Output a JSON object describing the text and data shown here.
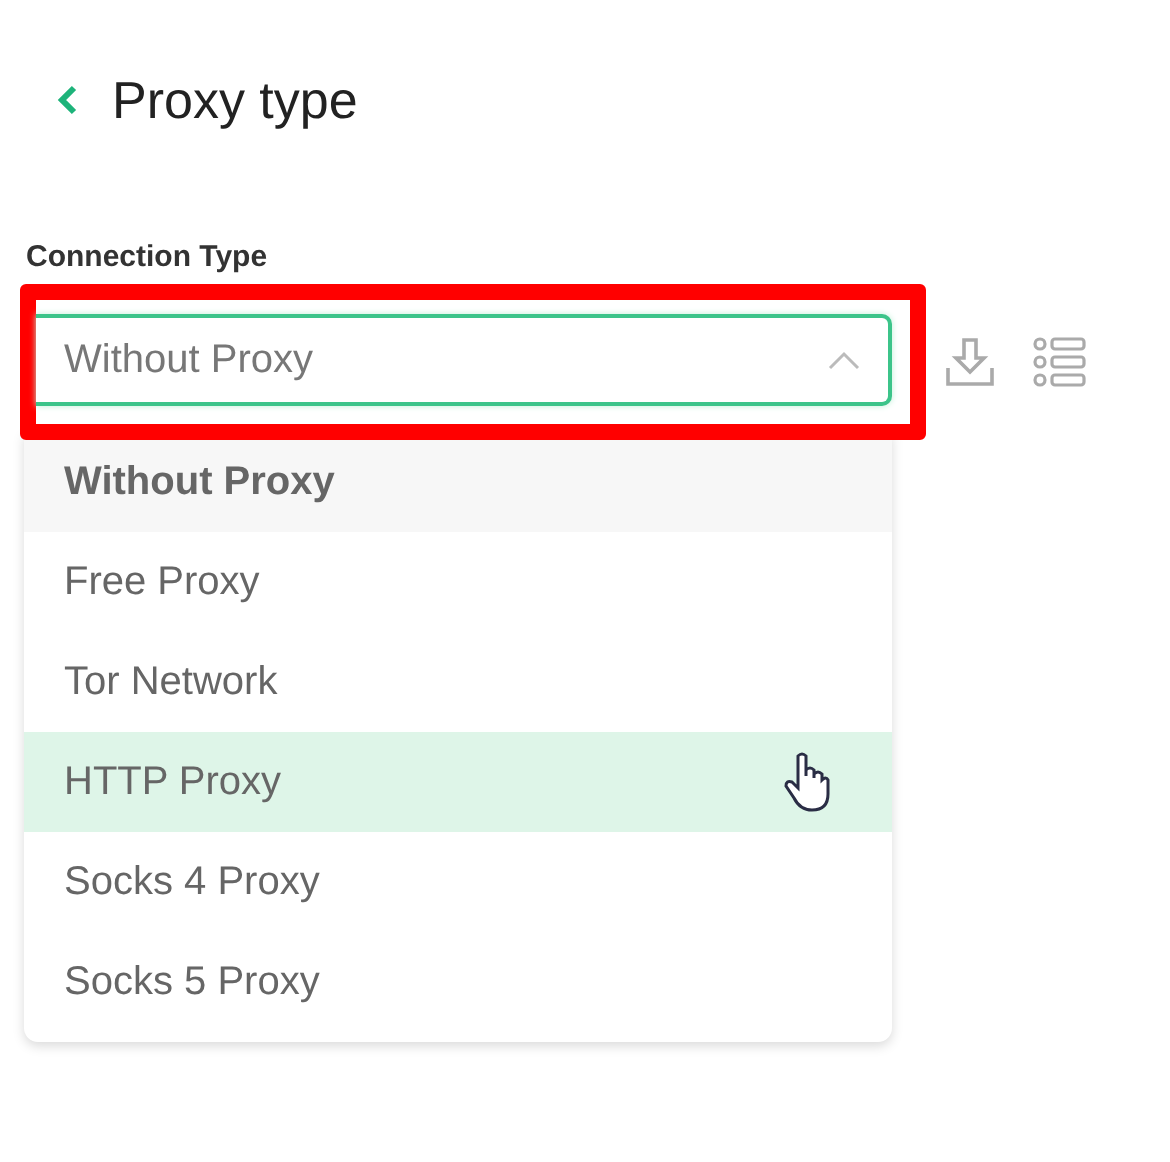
{
  "header": {
    "title": "Proxy type"
  },
  "connection_type": {
    "label": "Connection Type",
    "value": "Without Proxy",
    "expanded": true,
    "options": [
      {
        "label": "Without Proxy",
        "selected": true,
        "hovered": false
      },
      {
        "label": "Free Proxy",
        "selected": false,
        "hovered": false
      },
      {
        "label": "Tor Network",
        "selected": false,
        "hovered": false
      },
      {
        "label": "HTTP Proxy",
        "selected": false,
        "hovered": true
      },
      {
        "label": "Socks 4 Proxy",
        "selected": false,
        "hovered": false
      },
      {
        "label": "Socks 5 Proxy",
        "selected": false,
        "hovered": false
      }
    ]
  }
}
